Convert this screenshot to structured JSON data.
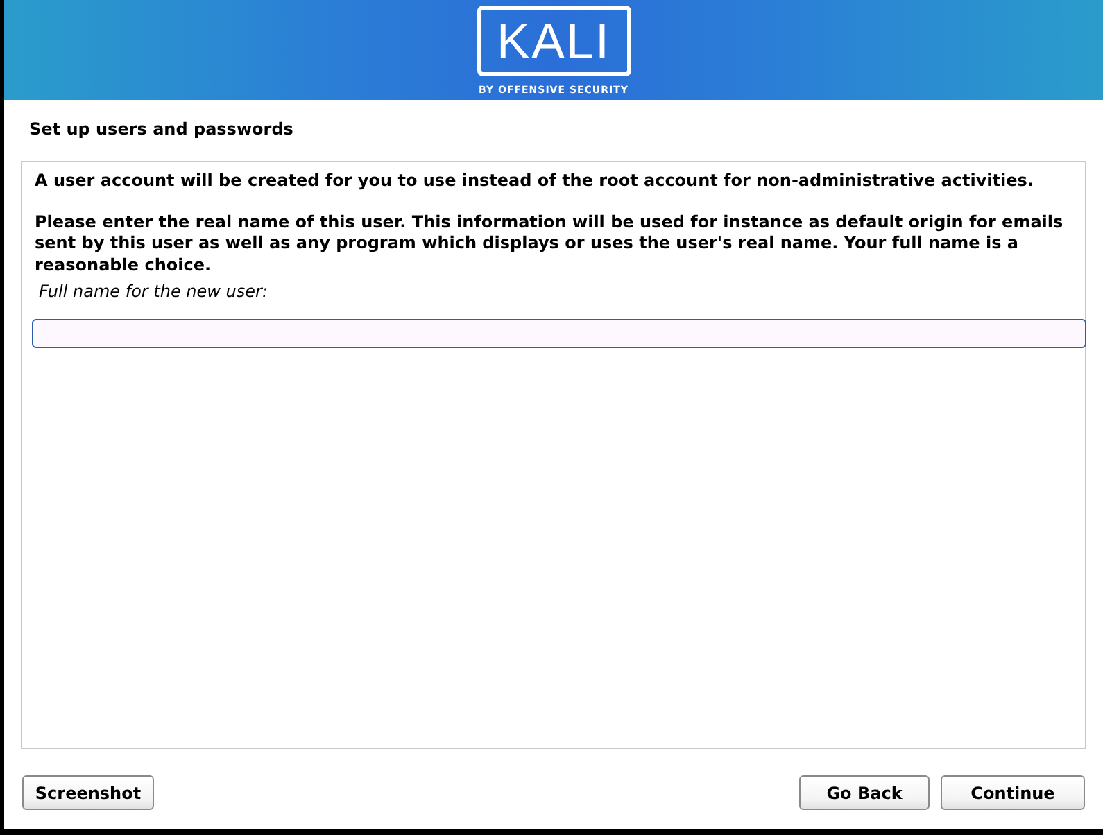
{
  "header": {
    "logo_text": "KALI",
    "logo_tagline": "BY OFFENSIVE SECURITY"
  },
  "page_title": "Set up users and passwords",
  "paragraphs": [
    "A user account will be created for you to use instead of the root account for non-administrative activities.",
    "Please enter the real name of this user. This information will be used for instance as default origin for emails sent by this user as well as any program which displays or uses the user's real name. Your full name is a reasonable choice."
  ],
  "field": {
    "label": "Full name for the new user:",
    "focused": true
  },
  "left_buttons": [
    "Screenshot"
  ],
  "right_buttons": [
    "Go Back",
    "Continue"
  ]
}
